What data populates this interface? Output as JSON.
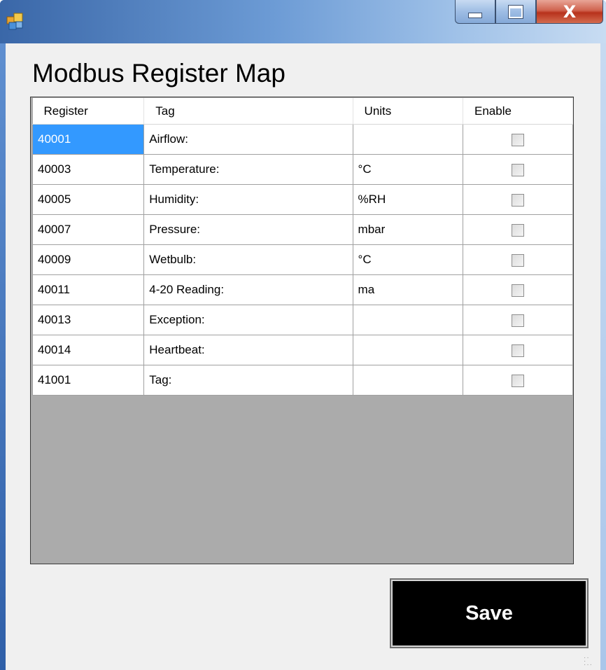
{
  "window": {
    "icon": "app-icon",
    "controls": {
      "minimize_icon": "minimize-icon",
      "maximize_icon": "maximize-icon",
      "close_label": "X"
    }
  },
  "page": {
    "title": "Modbus Register Map"
  },
  "grid": {
    "columns": [
      "Register",
      "Tag",
      "Units",
      "Enable"
    ],
    "rows": [
      {
        "register": "40001",
        "tag": "Airflow:",
        "units": "",
        "enabled": false,
        "selected": true
      },
      {
        "register": "40003",
        "tag": "Temperature:",
        "units": "°C",
        "enabled": false
      },
      {
        "register": "40005",
        "tag": "Humidity:",
        "units": "%RH",
        "enabled": false
      },
      {
        "register": "40007",
        "tag": "Pressure:",
        "units": "mbar",
        "enabled": false
      },
      {
        "register": "40009",
        "tag": "Wetbulb:",
        "units": "°C",
        "enabled": false
      },
      {
        "register": "40011",
        "tag": "4-20 Reading:",
        "units": "ma",
        "enabled": false
      },
      {
        "register": "40013",
        "tag": "Exception:",
        "units": "",
        "enabled": false
      },
      {
        "register": "40014",
        "tag": "Heartbeat:",
        "units": "",
        "enabled": false
      },
      {
        "register": "41001",
        "tag": "Tag:",
        "units": "",
        "enabled": false
      }
    ],
    "selection_color": "#3399ff"
  },
  "actions": {
    "save_label": "Save"
  }
}
